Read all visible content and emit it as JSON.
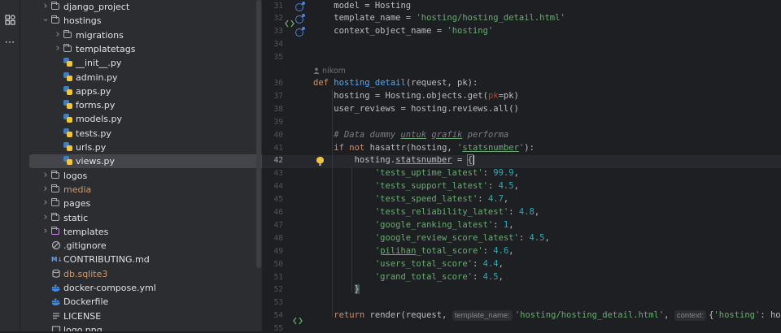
{
  "toolbar": {
    "icons": [
      "structure-icon",
      "more-icon"
    ],
    "more_glyph": "⋯"
  },
  "tree": {
    "items": [
      {
        "label": "django_project",
        "type": "folder",
        "depth": 0,
        "expanded": false
      },
      {
        "label": "hostings",
        "type": "folder",
        "depth": 0,
        "expanded": true
      },
      {
        "label": "migrations",
        "type": "folder",
        "depth": 1,
        "expanded": false
      },
      {
        "label": "templatetags",
        "type": "folder",
        "depth": 1,
        "expanded": false
      },
      {
        "label": "__init__.py",
        "type": "py",
        "depth": 1
      },
      {
        "label": "admin.py",
        "type": "py",
        "depth": 1
      },
      {
        "label": "apps.py",
        "type": "py",
        "depth": 1
      },
      {
        "label": "forms.py",
        "type": "py",
        "depth": 1
      },
      {
        "label": "models.py",
        "type": "py",
        "depth": 1
      },
      {
        "label": "tests.py",
        "type": "py",
        "depth": 1
      },
      {
        "label": "urls.py",
        "type": "py",
        "depth": 1
      },
      {
        "label": "views.py",
        "type": "py",
        "depth": 1,
        "selected": true
      },
      {
        "label": "logos",
        "type": "folder",
        "depth": 0,
        "expanded": false
      },
      {
        "label": "media",
        "type": "folder",
        "depth": 0,
        "expanded": false,
        "color": "#d29a6b"
      },
      {
        "label": "pages",
        "type": "folder",
        "depth": 0,
        "expanded": false
      },
      {
        "label": "static",
        "type": "folder",
        "depth": 0,
        "expanded": false
      },
      {
        "label": "templates",
        "type": "folder",
        "depth": 0,
        "expanded": false,
        "purple": true
      },
      {
        "label": ".gitignore",
        "type": "gitignore",
        "depth": 0
      },
      {
        "label": "CONTRIBUTING.md",
        "type": "md",
        "depth": 0
      },
      {
        "label": "db.sqlite3",
        "type": "db",
        "depth": 0,
        "color": "#d29a6b"
      },
      {
        "label": "docker-compose.yml",
        "type": "docker",
        "depth": 0
      },
      {
        "label": "Dockerfile",
        "type": "docker",
        "depth": 0
      },
      {
        "label": "LICENSE",
        "type": "text",
        "depth": 0
      },
      {
        "label": "logo.png",
        "type": "image",
        "depth": 0
      }
    ],
    "md_badge": "M↓"
  },
  "editor": {
    "author_hint": "nikom",
    "current_line": "42",
    "param_hints": {
      "template_name": "template_name:",
      "context": "context:"
    },
    "lines": [
      {
        "n": "31",
        "text": "    model = Hosting"
      },
      {
        "n": "32",
        "text": "    template_name = 'hosting/hosting_detail.html'"
      },
      {
        "n": "33",
        "text": "    context_object_name = 'hosting'"
      },
      {
        "n": "34",
        "text": ""
      },
      {
        "n": "35",
        "text": ""
      },
      {
        "n": "36",
        "text": "def hosting_detail(request, pk):"
      },
      {
        "n": "37",
        "text": "    hosting = Hosting.objects.get(pk=pk)"
      },
      {
        "n": "38",
        "text": "    user_reviews = hosting.reviews.all()"
      },
      {
        "n": "39",
        "text": ""
      },
      {
        "n": "40",
        "text": "    # Data dummy untuk grafik performa"
      },
      {
        "n": "41",
        "text": "    if not hasattr(hosting, 'statsnumber'):"
      },
      {
        "n": "42",
        "text": "        hosting.statsnumber = {"
      },
      {
        "n": "43",
        "text": "            'tests_uptime_latest': 99.9,"
      },
      {
        "n": "44",
        "text": "            'tests_support_latest': 4.5,"
      },
      {
        "n": "45",
        "text": "            'tests_speed_latest': 4.7,"
      },
      {
        "n": "46",
        "text": "            'tests_reliability_latest': 4.8,"
      },
      {
        "n": "47",
        "text": "            'google_ranking_latest': 1,"
      },
      {
        "n": "48",
        "text": "            'google_review_score_latest': 4.5,"
      },
      {
        "n": "49",
        "text": "            'pilihan_total_score': 4.6,"
      },
      {
        "n": "50",
        "text": "            'users_total_score': 4.4,"
      },
      {
        "n": "51",
        "text": "            'grand_total_score': 4.5,"
      },
      {
        "n": "52",
        "text": "        }"
      },
      {
        "n": "53",
        "text": ""
      },
      {
        "n": "54",
        "text": "    return render(request, template_name: 'hosting/hosting_detail.html', context: {'hosting': hosting,"
      },
      {
        "n": "55",
        "text": ""
      }
    ]
  },
  "colors": {
    "keyword": "#cf8e6d",
    "function": "#56a8f5",
    "string": "#6aab73",
    "number": "#2aacb8",
    "comment": "#7a7e85"
  }
}
